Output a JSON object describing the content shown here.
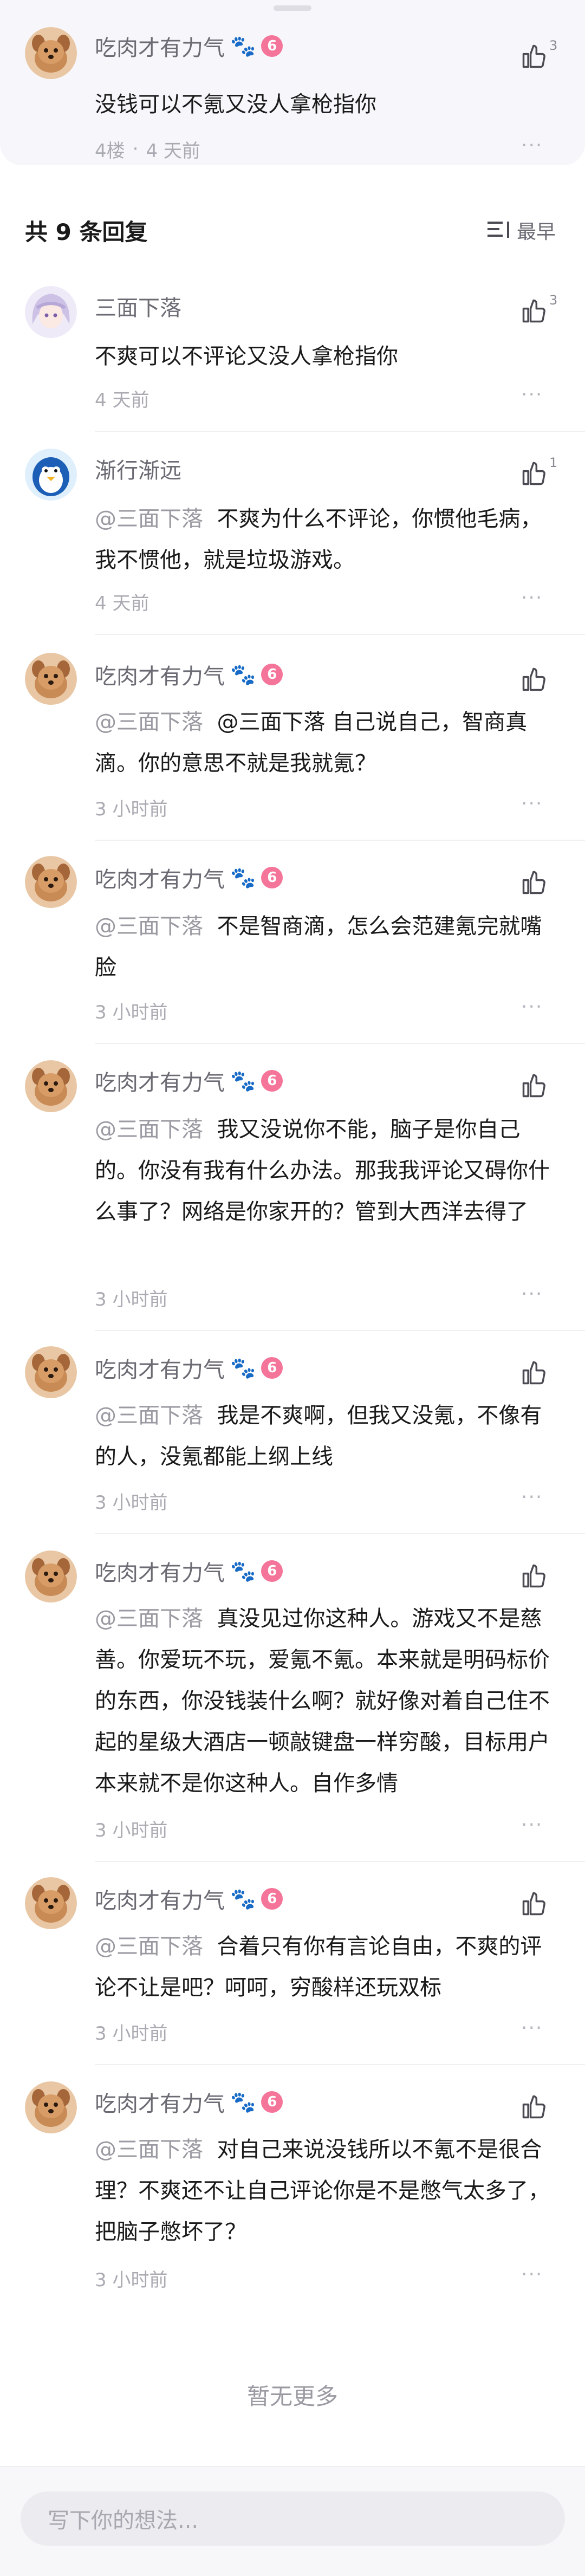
{
  "main_comment": {
    "user": "吃肉才有力气",
    "badge_paw": "🐾",
    "badge_level": "6",
    "text": "没钱可以不氪又没人拿枪指你",
    "floor": "4楼",
    "time": "4 天前",
    "likes": "3",
    "more": "···"
  },
  "replies_header": {
    "title": "共 9 条回复",
    "sort_label": "最早"
  },
  "replies": [
    {
      "user": "三面下落",
      "reply_to": "",
      "text": "不爽可以不评论又没人拿枪指你",
      "time": "4 天前",
      "likes": "3",
      "avatar": "anime-avatar",
      "more": "···"
    },
    {
      "user": "渐行渐远",
      "reply_to": "@三面下落",
      "text": "不爽为什么不评论，你惯他毛病，我不惯他，就是垃圾游戏。",
      "time": "4 天前",
      "likes": "1",
      "avatar": "penguin-avatar",
      "more": "···"
    },
    {
      "user": "吃肉才有力气",
      "badge_paw": "🐾",
      "badge_level": "6",
      "reply_to": "@三面下落",
      "text": "@三面下落 自己说自己，智商真滴。你的意思不就是我就氪？",
      "time": "3 小时前",
      "likes": "",
      "avatar": "dog-avatar",
      "more": "···"
    },
    {
      "user": "吃肉才有力气",
      "badge_paw": "🐾",
      "badge_level": "6",
      "reply_to": "@三面下落",
      "text": "不是智商滴，怎么会范建氪完就嘴脸",
      "time": "3 小时前",
      "likes": "",
      "avatar": "dog-avatar",
      "more": "···"
    },
    {
      "user": "吃肉才有力气",
      "badge_paw": "🐾",
      "badge_level": "6",
      "reply_to": "@三面下落",
      "text": "我又没说你不能，脑子是你自己的。你没有我有什么办法。那我我评论又碍你什么事了？网络是你家开的？管到大西洋去得了",
      "time": "3 小时前",
      "likes": "",
      "avatar": "dog-avatar",
      "more": "···"
    },
    {
      "user": "吃肉才有力气",
      "badge_paw": "🐾",
      "badge_level": "6",
      "reply_to": "@三面下落",
      "text": "我是不爽啊，但我又没氪，不像有的人，没氪都能上纲上线",
      "time": "3 小时前",
      "likes": "",
      "avatar": "dog-avatar",
      "more": "···"
    },
    {
      "user": "吃肉才有力气",
      "badge_paw": "🐾",
      "badge_level": "6",
      "reply_to": "@三面下落",
      "text": "真没见过你这种人。游戏又不是慈善。你爱玩不玩，爱氪不氪。本来就是明码标价的东西，你没钱装什么啊？就好像对着自己住不起的星级大酒店一顿敲键盘一样穷酸，目标用户本来就不是你这种人。自作多情",
      "time": "3 小时前",
      "likes": "",
      "avatar": "dog-avatar",
      "more": "···"
    },
    {
      "user": "吃肉才有力气",
      "badge_paw": "🐾",
      "badge_level": "6",
      "reply_to": "@三面下落",
      "text": "合着只有你有言论自由，不爽的评论不让是吧？呵呵，穷酸样还玩双标",
      "time": "3 小时前",
      "likes": "",
      "avatar": "dog-avatar",
      "more": "···"
    },
    {
      "user": "吃肉才有力气",
      "badge_paw": "🐾",
      "badge_level": "6",
      "reply_to": "@三面下落",
      "text": "对自己来说没钱所以不氪不是很合理？不爽还不让自己评论你是不是憋气太多了，把脑子憋坏了？",
      "time": "3 小时前",
      "likes": "",
      "avatar": "dog-avatar",
      "more": "···"
    }
  ],
  "footer": {
    "no_more": "暂无更多",
    "input_placeholder": "写下你的想法..."
  }
}
